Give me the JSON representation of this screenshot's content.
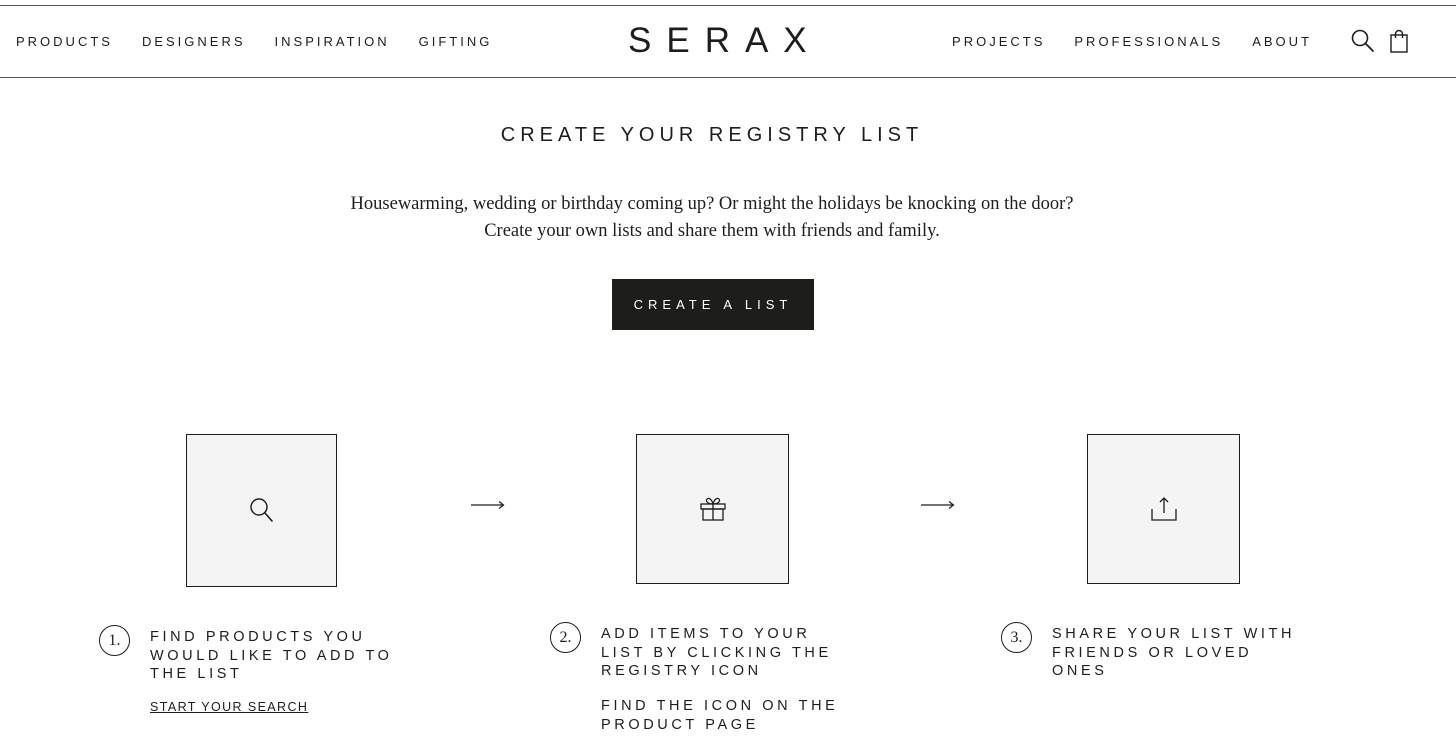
{
  "header": {
    "nav_left": [
      {
        "label": "PRODUCTS"
      },
      {
        "label": "DESIGNERS"
      },
      {
        "label": "INSPIRATION"
      },
      {
        "label": "GIFTING"
      }
    ],
    "logo": "SERAX",
    "nav_right": [
      {
        "label": "PROJECTS"
      },
      {
        "label": "PROFESSIONALS"
      },
      {
        "label": "ABOUT"
      }
    ],
    "icons": [
      "search-icon",
      "shopping-bag-icon"
    ]
  },
  "main": {
    "title": "CREATE YOUR REGISTRY LIST",
    "intro_line1": "Housewarming, wedding or birthday coming up? Or might the holidays be knocking on the door?",
    "intro_line2": "Create your own lists and share them with friends and family.",
    "cta_label": "CREATE A LIST"
  },
  "steps": [
    {
      "number": "1.",
      "icon": "search-icon",
      "text": "FIND PRODUCTS YOU WOULD LIKE TO ADD TO THE LIST",
      "link": "START YOUR SEARCH"
    },
    {
      "number": "2.",
      "icon": "gift-icon",
      "text": "ADD ITEMS TO YOUR LIST BY CLICKING THE REGISTRY ICON",
      "subtext": "FIND THE ICON ON THE PRODUCT PAGE"
    },
    {
      "number": "3.",
      "icon": "share-icon",
      "text": "SHARE YOUR LIST WITH FRIENDS OR LOVED ONES"
    }
  ],
  "colors": {
    "text": "#1d1d1b",
    "button_bg": "#1d1d1b",
    "box_bg": "#f4f4f4"
  }
}
